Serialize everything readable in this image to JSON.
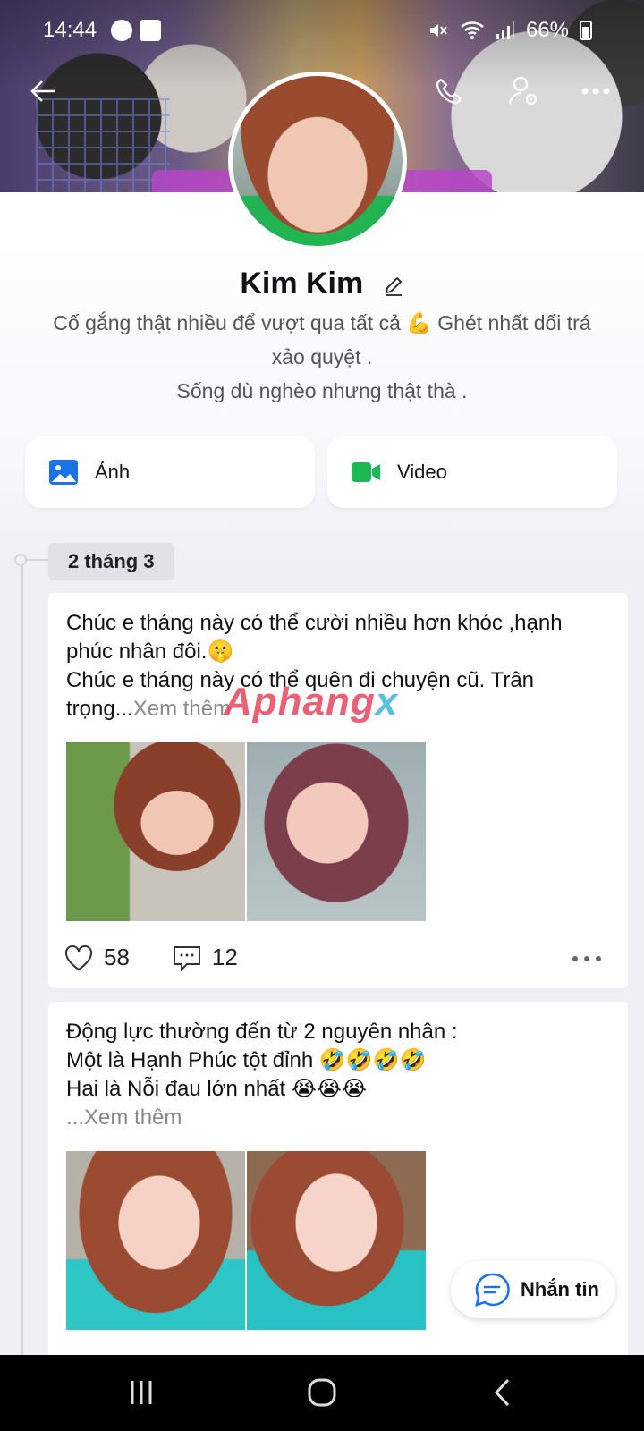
{
  "status_bar": {
    "time": "14:44",
    "battery": "66%"
  },
  "profile": {
    "name": "Kim Kim",
    "bio_lines": [
      "Cố gắng thật nhiều để vượt qua tất cả 💪 Ghét nhất dối trá",
      "xảo quyệt .",
      "Sống dù nghèo nhưng thật thà ."
    ]
  },
  "media_buttons": {
    "photos_label": "Ảnh",
    "video_label": "Video"
  },
  "timeline": {
    "date_label": "2 tháng 3",
    "posts": [
      {
        "text_lines": [
          "Chúc e tháng này có thể cười nhiều hơn khóc ,hạnh",
          "phúc nhân đôi.🤫",
          "Chúc e tháng này có thể quên đi chuyện cũ. Trân"
        ],
        "last_line_prefix": "trọng...",
        "more_label": "Xem thêm",
        "likes": "58",
        "comments": "12"
      },
      {
        "text_lines": [
          "Động lực thường đến từ 2 nguyên nhân :",
          "Một là Hạnh Phúc tột đỉnh 🤣🤣🤣🤣",
          "Hai là Nỗi đau lớn nhất 😭😭😭"
        ],
        "last_line_prefix": "...",
        "more_label": "Xem thêm"
      }
    ]
  },
  "watermark": {
    "part1": "Aphang",
    "part2": "x"
  },
  "chat_fab": {
    "label": "Nhắn tin"
  },
  "colors": {
    "accent_blue": "#1a73e8",
    "video_green": "#1db954",
    "chip_bg": "#dfe2e6"
  }
}
